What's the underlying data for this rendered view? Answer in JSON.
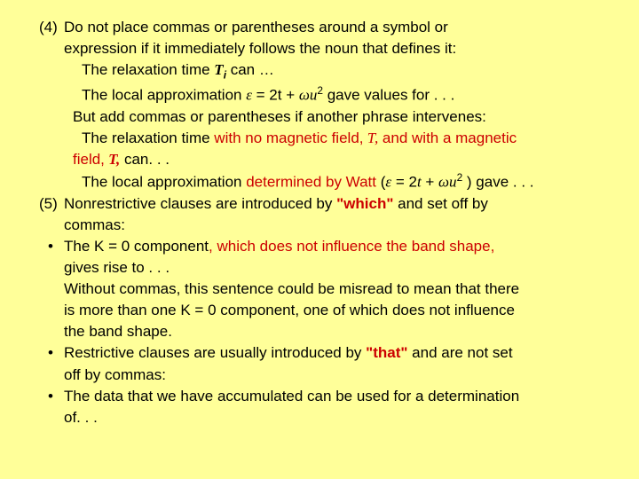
{
  "rule4": {
    "num": "(4)",
    "l1a": "Do not place commas or parentheses around a symbol or",
    "l1b": "expression if it immediately follows the noun that defines it:",
    "ex1a": "The relaxation time ",
    "ex1a_sym": "T",
    "ex1a_sub": "i",
    "ex1a_tail": " can …",
    "ex2a": "The local approximation ",
    "ex2a_eps": "ε",
    "ex2a_mid": "  = 2t + ",
    "ex2a_omega": "ωu",
    "ex2a_sup": "2",
    "ex2a_tail": " gave values  for . . .",
    "but": "But add commas or parentheses if another phrase intervenes:",
    "ex3a": "The relaxation time ",
    "ex3a_red1": "with no magnetic field,",
    "ex3a_T": " T,",
    "ex3a_red2": " and with a magnetic",
    "ex3b_red1": "field,",
    "ex3b_T": " T,",
    "ex3b_tail": " can. . .",
    "ex4a": "The local approximation ",
    "ex4a_red": "determined by Watt ",
    "ex4a_open": " (",
    "ex4a_eps": "ε",
    "ex4a_mid": "  = 2",
    "ex4a_t": "t",
    "ex4a_plus": " + ",
    "ex4a_omega": "ωu",
    "ex4a_sup": "2",
    "ex4a_close": " ) gave . . ."
  },
  "rule5": {
    "num": "(5)",
    "l1a": "Nonrestrictive clauses are introduced by ",
    "l1a_red": "\"which\"",
    "l1a_tail": " and set off by",
    "l1b": "commas:"
  },
  "b1": {
    "dot": "•",
    "l1": "The K = 0 component",
    "l1_red": ", which does not influence the band shape,",
    "l2": "gives rise to . . .",
    "l3": "Without commas, this sentence could be misread to mean that there",
    "l4": "is more than one K = 0 component, one of which does not influence",
    "l5": "the band shape."
  },
  "b2": {
    "dot": "•",
    "l1": "Restrictive clauses are usually introduced by ",
    "l1_red": "\"that\"",
    "l1_tail": " and are not set",
    "l2": "off by commas:"
  },
  "b3": {
    "dot": "•",
    "l1": "The data that we have accumulated can be used for a determination",
    "l2": "of. . ."
  }
}
